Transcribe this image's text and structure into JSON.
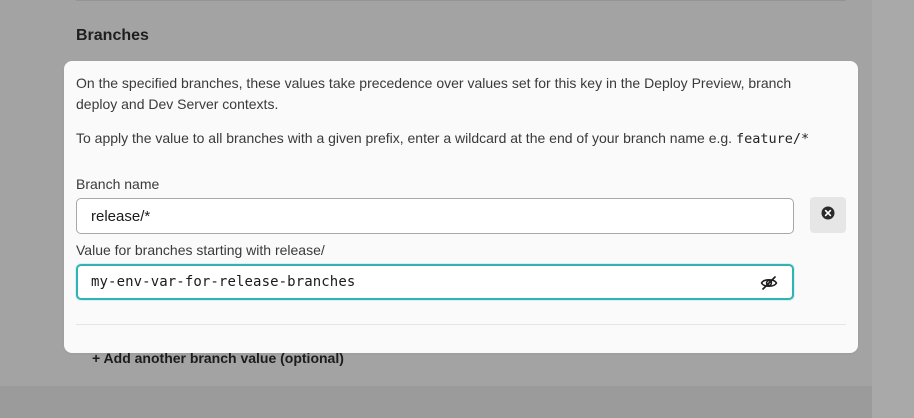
{
  "background": {
    "section_heading": "Branches",
    "add_branch_link": "+ Add another branch value (optional)"
  },
  "dialog": {
    "description_1": "On the specified branches, these values take precedence over values set for this key in the Deploy Preview, branch deploy and Dev Server contexts.",
    "description_2": "To apply the value to all branches with a given prefix, enter a wildcard at the end of your branch name e.g.",
    "description_2_example": "feature/*",
    "branch_name_label": "Branch name",
    "branch_name_value": "release/*",
    "value_label": "Value for branches starting with release/",
    "value_input": "my-env-var-for-release-branches"
  },
  "icons": {
    "clear": "close-circle-icon",
    "visibility": "eye-off-icon"
  },
  "colors": {
    "focus_border": "#2fb3b5",
    "overlay": "#a3a3a3",
    "card_background": "#fafafa"
  }
}
